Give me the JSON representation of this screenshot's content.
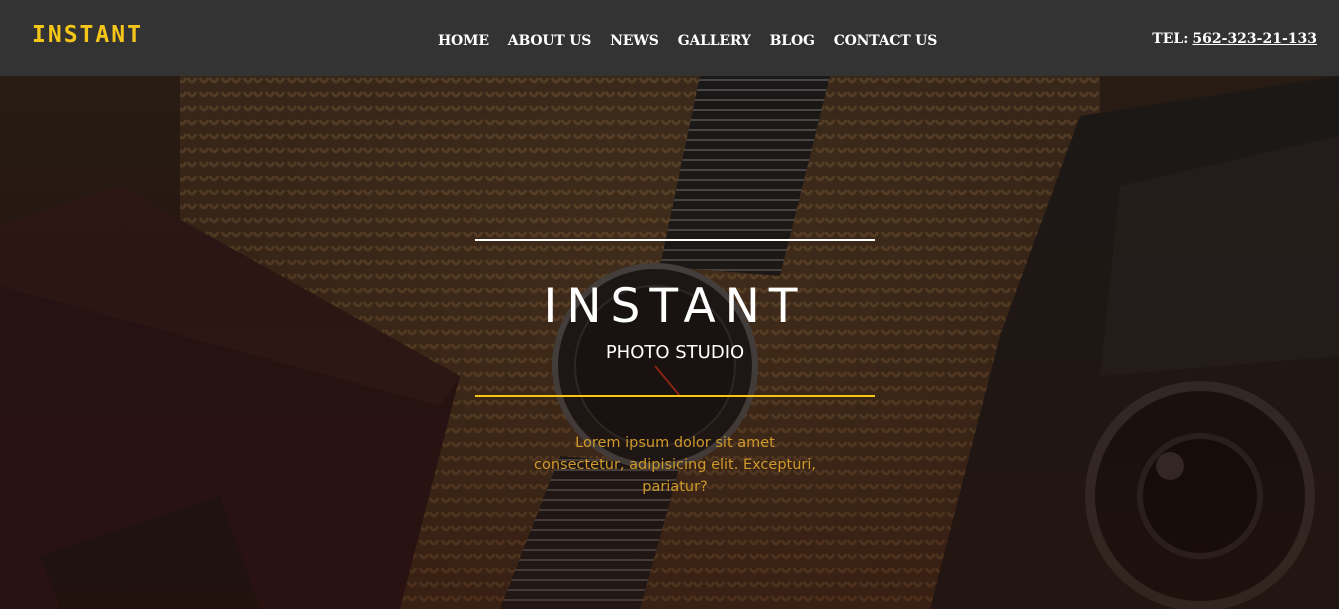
{
  "brand": {
    "logo": "INSTANT",
    "accent_color": "#f5c518"
  },
  "nav": {
    "items": [
      "HOME",
      "ABOUT US",
      "NEWS",
      "GALLERY",
      "BLOG",
      "CONTACT US"
    ]
  },
  "contact": {
    "tel_label": "TEL:",
    "tel_number": "562-323-21-133"
  },
  "hero": {
    "title": "INSTANT",
    "subtitle": "PHOTO STUDIO",
    "text": "Lorem ipsum dolor sit amet consectetur, adipisicing elit. Excepturi, pariatur?"
  }
}
